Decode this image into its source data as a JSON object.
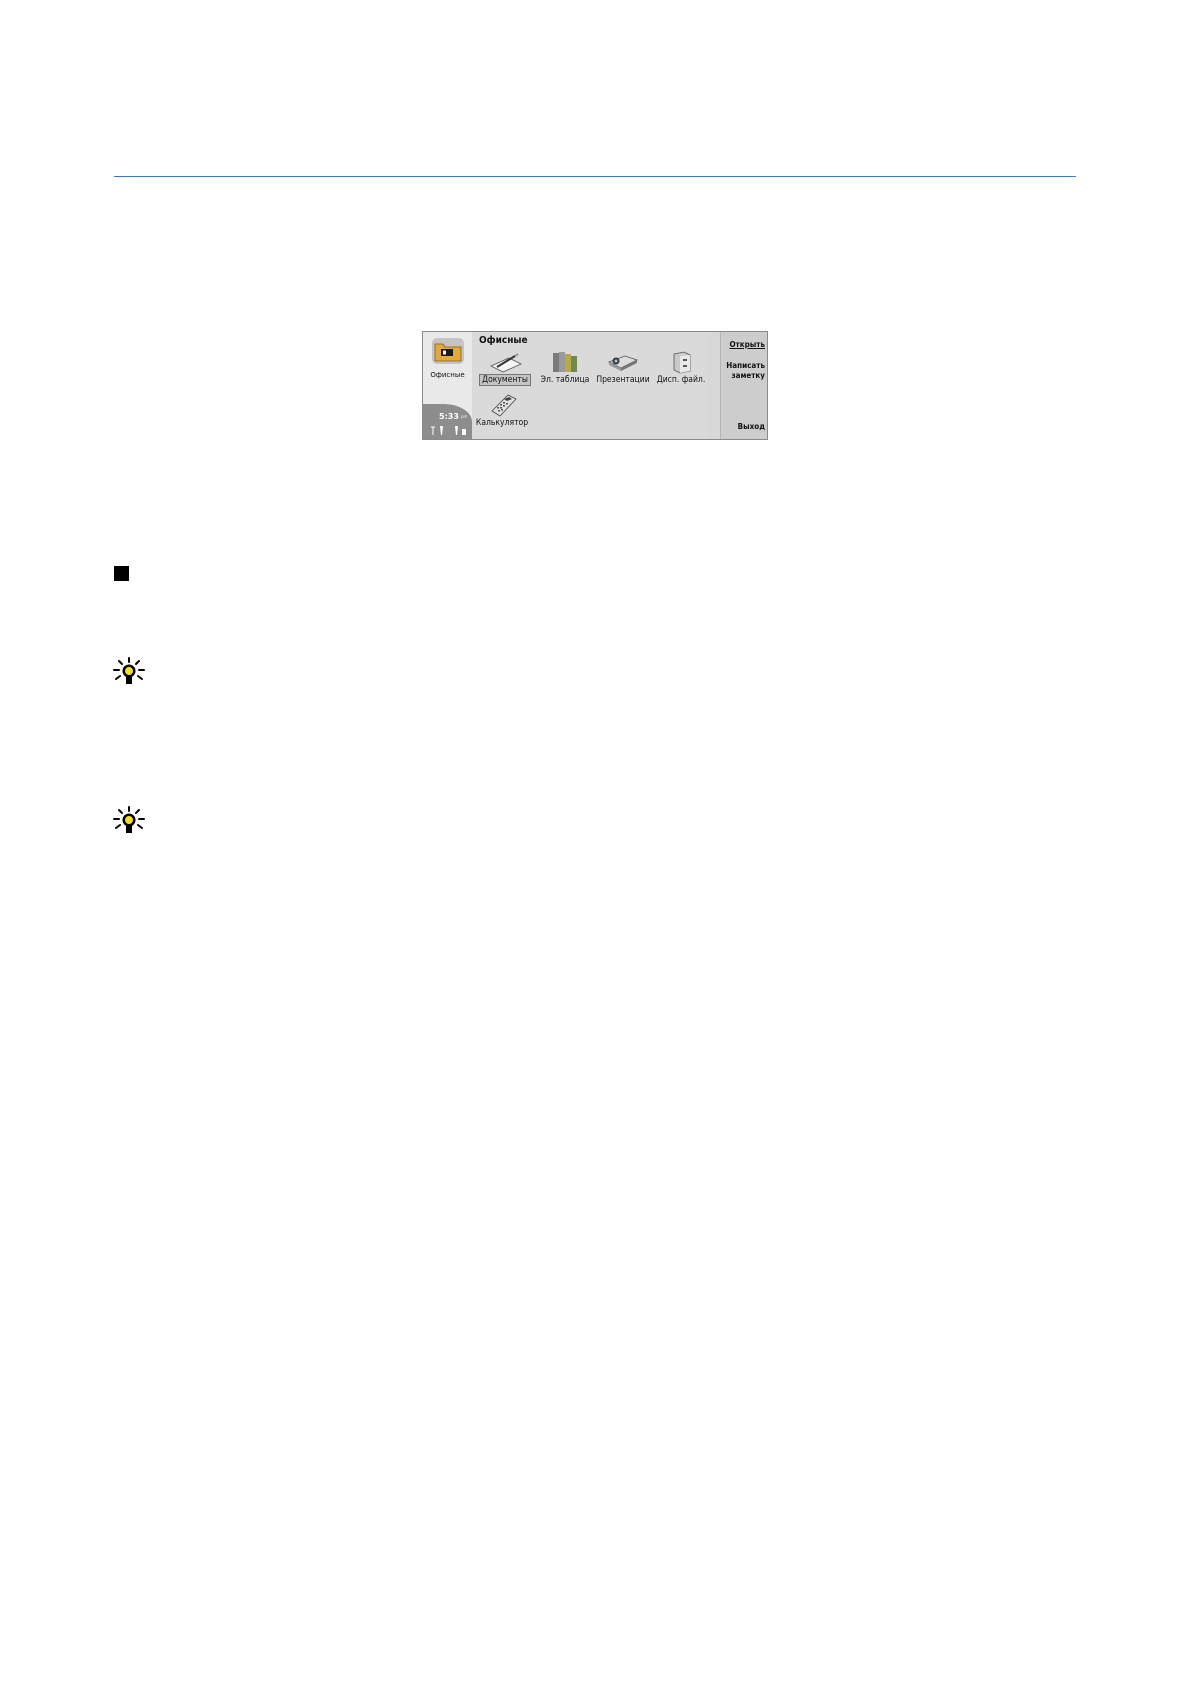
{
  "device_screen": {
    "category_label": "Офисные",
    "clock": "5:33",
    "clock_suffix": "pm",
    "title": "Офисные",
    "apps": [
      {
        "label": "Документы",
        "icon": "documents-pen-icon",
        "selected": true
      },
      {
        "label": "Эл. таблица",
        "icon": "spreadsheet-binders-icon",
        "selected": false
      },
      {
        "label": "Презентации",
        "icon": "projector-icon",
        "selected": false
      },
      {
        "label": "Дисп. файл.",
        "icon": "file-cabinet-icon",
        "selected": false
      },
      {
        "label": "Калькулятор",
        "icon": "calculator-icon",
        "selected": false
      }
    ],
    "softkeys": {
      "open": "Открыть",
      "write_note_line1": "Написать",
      "write_note_line2": "заметку",
      "exit": "Выход"
    }
  },
  "colors": {
    "rule": "#3d78c8",
    "folder": "#e2a93c",
    "screen_bg": "#dadada"
  }
}
